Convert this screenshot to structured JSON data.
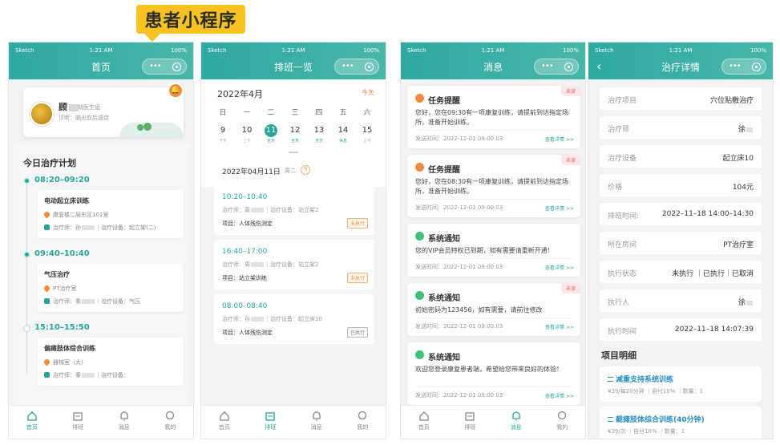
{
  "banner": "患者小程序",
  "status_bar": {
    "carrier": "Sketch",
    "time": "1:21 AM",
    "battery": "100%"
  },
  "tabbar": [
    "首页",
    "排班",
    "消息",
    "我的"
  ],
  "colors": {
    "primary": "#2fa9a1",
    "accent": "#f08a3c",
    "unread": "#e05a5a"
  },
  "home": {
    "title": "首页",
    "profile": {
      "name": "顾",
      "group": "胡医生组",
      "diagnosis": "诊断：脑出血后遗症"
    },
    "plan_title": "今日治疗计划",
    "items": [
      {
        "time": "08:20–09:20",
        "title": "电动起立床训练",
        "room": "康复楼二层东区101室",
        "staff": "治疗师：孙",
        "device": "｜治疗设备：起立架(二)"
      },
      {
        "time": "09:40–10:40",
        "title": "气压治疗",
        "room": "PT治疗室",
        "staff": "治疗师：秦",
        "device": "｜治疗设备：气压"
      },
      {
        "time": "15:10–15:50",
        "title": "偏瘫肢体综合训练",
        "room": "器械室（大）",
        "staff": "治疗师：秦",
        "device": "｜治疗设备："
      }
    ]
  },
  "schedule": {
    "title": "排班一览",
    "month": "2022年4月",
    "today": "今天",
    "weekdays": [
      "日",
      "一",
      "二",
      "三",
      "四",
      "五",
      "六"
    ],
    "days": [
      {
        "num": "9",
        "sub": "下午"
      },
      {
        "num": "10",
        "sub": "上午"
      },
      {
        "num": "11",
        "sub": "全天"
      },
      {
        "num": "12",
        "sub": "全天"
      },
      {
        "num": "13",
        "sub": "全天"
      },
      {
        "num": "14",
        "sub": "休息"
      },
      {
        "num": "15",
        "sub": "上午"
      }
    ],
    "date": "2022年04月11日",
    "weekday": "周二",
    "date_badge": "今",
    "cards": [
      {
        "time": "10:20–10:40",
        "staff": "治疗师：周",
        "device": "｜治疗设备：站立架2",
        "project": "项目：人体残伤测定",
        "status": "未执行"
      },
      {
        "time": "16:40–17:00",
        "staff": "治疗师：周",
        "device": "｜治疗设备：站立架2",
        "project": "项目：站立架训练",
        "status": "未执行"
      },
      {
        "time": "08:00–08:40",
        "staff": "治疗师：孙",
        "device": "｜治疗设备：起立床10",
        "project": "项目：人体残伤测定",
        "status": "已执行"
      }
    ]
  },
  "messages": {
    "title": "消息",
    "unread_label": "未读",
    "more_label": "查看详情 >>",
    "list": [
      {
        "title": "任务提醒",
        "body": "您好，您在09:30有一项康复训练，请提前到达指定场所，准备开始训练。",
        "time": "发送时间：2022-12-01 09:00:03",
        "unread": true,
        "kind": "task"
      },
      {
        "title": "任务提醒",
        "body": "您好，您在08:30有一项康复训练，请提前到达指定场所，准备开始训练。",
        "time": "发送时间：2022-12-01 09:00:03",
        "unread": true,
        "kind": "task"
      },
      {
        "title": "系统通知",
        "body": "您的VIP会员特权已到期，如有需要请重新开通！",
        "time": "发送时间：2022-12-01 09:00:03",
        "unread": false,
        "kind": "system"
      },
      {
        "title": "系统通知",
        "body": "初始密码为123456，如有需要，请前往修改",
        "time": "发送时间：2022-12-01 09:00:03",
        "unread": true,
        "kind": "system"
      },
      {
        "title": "系统通知",
        "body": "欢迎您登录康复患者端，希望给您带来良好的体验！",
        "time": "发送时间：2022-12-01 09:00:03",
        "unread": false,
        "kind": "system"
      }
    ]
  },
  "detail": {
    "title": "治疗详情",
    "rows": [
      {
        "label": "治疗项目",
        "value": "穴位贴敷治疗"
      },
      {
        "label": "治疗师",
        "value": "徐"
      },
      {
        "label": "治疗设备",
        "value": "起立床10"
      },
      {
        "label": "价格",
        "value": "104元"
      },
      {
        "label": "排班时间:",
        "value": "2022–11–18 14:00–14:30"
      },
      {
        "label": "所在房间",
        "value": "PT治疗室"
      },
      {
        "label": "执行状态",
        "value": "未执行 ｜已执行｜已取消"
      },
      {
        "label": "执行人",
        "value": "徐"
      },
      {
        "label": "执行时间",
        "value": "2022–11–18 14:07:39"
      }
    ],
    "section": "项目明细",
    "projects": [
      {
        "name": "减重支持系统训练",
        "meta": "¥39/每20分钟 ｜自付10% ｜数量：1"
      },
      {
        "name": "截瘫肢体综合训练(40分钟)",
        "meta": "¥39/次 ｜自付10% ｜数量：1"
      }
    ]
  }
}
